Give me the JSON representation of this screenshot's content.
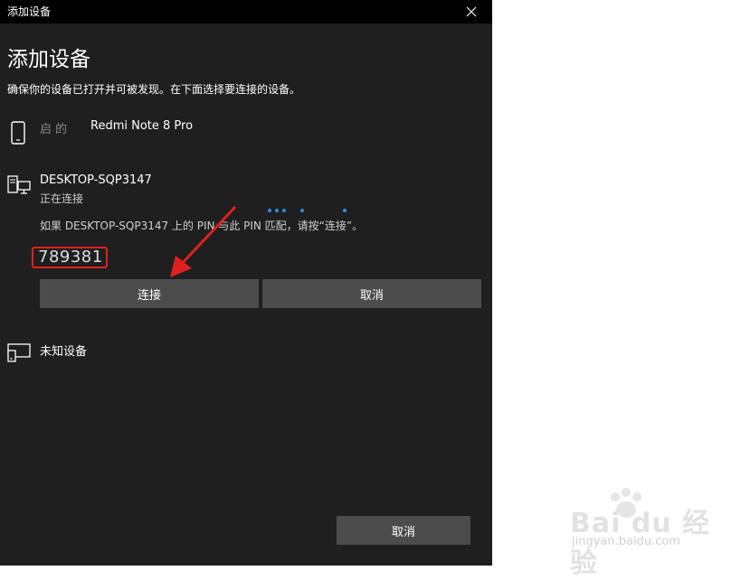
{
  "window": {
    "title": "添加设备",
    "close_icon": "close-icon"
  },
  "heading": "添加设备",
  "instruction": "确保你的设备已打开并可被发现。在下面选择要连接的设备。",
  "devices": [
    {
      "name": "Redmi Note 8 Pro",
      "name_prefix": "启   的",
      "icon": "phone-icon"
    },
    {
      "name": "DESKTOP-SQP3147",
      "status": "正在连接",
      "icon": "computer-icon",
      "pin_hint": "如果 DESKTOP-SQP3147 上的 PIN 与此 PIN 匹配，请按“连接”。",
      "pin": "789381",
      "connect_label": "连接",
      "cancel_label": "取消"
    },
    {
      "name": "未知设备",
      "icon": "display-device-icon"
    }
  ],
  "footer": {
    "cancel_label": "取消"
  },
  "watermark": {
    "main": "Bai du 经验",
    "sub": "jingyan.baidu.com"
  },
  "colors": {
    "dialog_bg": "#1f1f1f",
    "titlebar_bg": "#000000",
    "button_bg": "#4c4c4c",
    "accent": "#2b8fe6",
    "highlight": "#e02020"
  }
}
